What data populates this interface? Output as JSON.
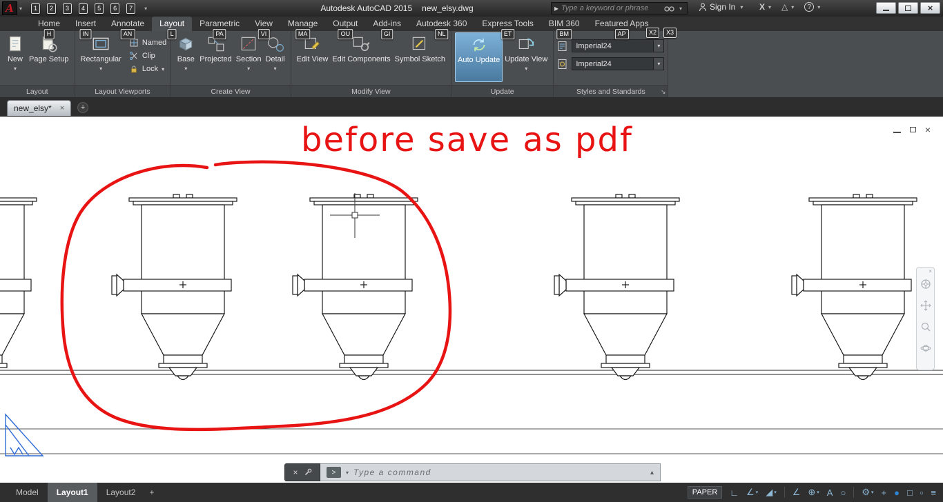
{
  "title_bar": {
    "title_app": "Autodesk AutoCAD 2015",
    "title_doc": "new_elsy.dwg",
    "search_placeholder": "Type a keyword or phrase",
    "sign_in": "Sign In",
    "qat_keytips": [
      "1",
      "2",
      "3",
      "4",
      "5",
      "6",
      "7"
    ]
  },
  "ribbon": {
    "tabs": [
      {
        "label": "Home",
        "keytip": "H"
      },
      {
        "label": "Insert",
        "keytip": "IN"
      },
      {
        "label": "Annotate",
        "keytip": "AN"
      },
      {
        "label": "Layout",
        "keytip": "L"
      },
      {
        "label": "Parametric",
        "keytip": "PA"
      },
      {
        "label": "View",
        "keytip": "VI"
      },
      {
        "label": "Manage",
        "keytip": "MA"
      },
      {
        "label": "Output",
        "keytip": "OU"
      },
      {
        "label": "Add-ins",
        "keytip": "GI"
      },
      {
        "label": "Autodesk 360",
        "keytip": "NL"
      },
      {
        "label": "Express Tools",
        "keytip": "ET"
      },
      {
        "label": "BIM 360",
        "keytip": "BM"
      },
      {
        "label": "Featured Apps",
        "keytip": "AP"
      }
    ],
    "floating_keytips": [
      "X2",
      "X3"
    ],
    "panels": {
      "layout": {
        "label": "Layout",
        "new": "New",
        "page_setup": "Page Setup"
      },
      "viewports": {
        "label": "Layout Viewports",
        "rectangular": "Rectangular",
        "named": "Named",
        "clip": "Clip",
        "lock": "Lock"
      },
      "create_view": {
        "label": "Create View",
        "base": "Base",
        "projected": "Projected",
        "section": "Section",
        "detail": "Detail"
      },
      "modify_view": {
        "label": "Modify View",
        "edit_view": "Edit View",
        "edit_components": "Edit Components",
        "symbol_sketch": "Symbol Sketch"
      },
      "update": {
        "label": "Update",
        "auto_update": "Auto Update",
        "update_view": "Update View"
      },
      "styles": {
        "label": "Styles and Standards",
        "combo1": "Imperial24",
        "combo2": "Imperial24"
      }
    }
  },
  "file_tabs": {
    "active": "new_elsy*"
  },
  "canvas": {
    "annotation": "before save as pdf",
    "annotation_color": "#e81414"
  },
  "command_line": {
    "prompt": ">",
    "placeholder": "Type a command"
  },
  "status_bar": {
    "model": "Model",
    "layout1": "Layout1",
    "layout2": "Layout2",
    "paper": "PAPER"
  },
  "glyphs": {
    "dropdown": "▾",
    "close": "×",
    "plus": "+",
    "search_arrow": "▸",
    "x_mark": "X",
    "triangle": "△",
    "question": "?",
    "cmd_up": "▴",
    "launcher": "↘",
    "ortho": "∟",
    "polar": "∠",
    "iso": "◢",
    "otrack": "∠",
    "osnap": "⊕",
    "annot_vis": "A",
    "autoscale": "○",
    "gear": "⚙",
    "monitor": "+",
    "perf": "●",
    "isolate": "□",
    "clean": "▫",
    "custom": "≡"
  }
}
